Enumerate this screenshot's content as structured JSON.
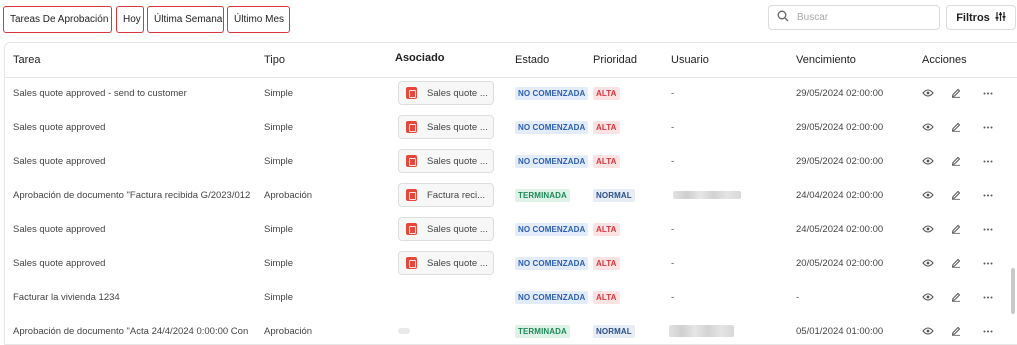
{
  "filters": {
    "chips": [
      "Tareas De Aprobación",
      "Hoy",
      "Última Semana",
      "Último Mes"
    ],
    "search_placeholder": "Buscar",
    "filters_label": "Filtros"
  },
  "table": {
    "columns": [
      "Tarea",
      "Tipo",
      "Asociado",
      "Estado",
      "Prioridad",
      "Usuario",
      "Vencimiento",
      "Acciones"
    ],
    "rows": [
      {
        "tarea": "Sales quote approved - send to customer",
        "tipo": "Simple",
        "asociado": "Sales quote ...",
        "estado": "NO COMENZADA",
        "prioridad": "ALTA",
        "usuario": "-",
        "vencimiento": "29/05/2024 02:00:00"
      },
      {
        "tarea": "Sales quote approved",
        "tipo": "Simple",
        "asociado": "Sales quote ...",
        "estado": "NO COMENZADA",
        "prioridad": "ALTA",
        "usuario": "-",
        "vencimiento": "29/05/2024 02:00:00"
      },
      {
        "tarea": "Sales quote approved",
        "tipo": "Simple",
        "asociado": "Sales quote ...",
        "estado": "NO COMENZADA",
        "prioridad": "ALTA",
        "usuario": "-",
        "vencimiento": "29/05/2024 02:00:00"
      },
      {
        "tarea": "Aprobación de documento \"Factura recibida G/2023/012",
        "tipo": "Aprobación",
        "asociado": "Factura reci...",
        "estado": "TERMINADA",
        "prioridad": "NORMAL",
        "usuario": "",
        "vencimiento": "24/04/2024 02:00:00"
      },
      {
        "tarea": "Sales quote approved",
        "tipo": "Simple",
        "asociado": "Sales quote ...",
        "estado": "NO COMENZADA",
        "prioridad": "ALTA",
        "usuario": "-",
        "vencimiento": "24/05/2024 02:00:00"
      },
      {
        "tarea": "Sales quote approved",
        "tipo": "Simple",
        "asociado": "Sales quote ...",
        "estado": "NO COMENZADA",
        "prioridad": "ALTA",
        "usuario": "-",
        "vencimiento": "20/05/2024 02:00:00"
      },
      {
        "tarea": "Facturar la vivienda 1234",
        "tipo": "Simple",
        "asociado": "",
        "estado": "NO COMENZADA",
        "prioridad": "ALTA",
        "usuario": "-",
        "vencimiento": "-"
      },
      {
        "tarea": "Aprobación de documento \"Acta 24/4/2024 0:00:00 Con",
        "tipo": "Aprobación",
        "asociado": "",
        "estado": "TERMINADA",
        "prioridad": "NORMAL",
        "usuario": "",
        "vencimiento": "05/01/2024 01:00:00"
      }
    ]
  },
  "icons": {
    "search": "search-icon",
    "filters": "sliders-icon",
    "pdf": "pdf-icon",
    "view": "eye-icon",
    "edit": "pencil-icon",
    "more": "more-horizontal-icon"
  },
  "colors": {
    "chip_border": "#d9363e",
    "status_not_started": "#2d5fb3",
    "status_done": "#1e8a5a",
    "priority_high": "#d9363e",
    "priority_normal": "#2b4f8a"
  }
}
